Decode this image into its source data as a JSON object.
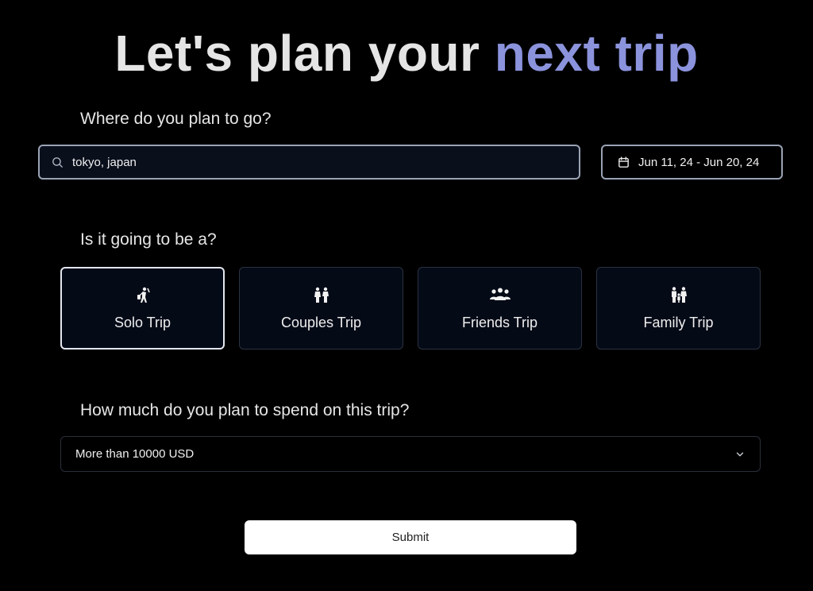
{
  "header": {
    "title_main": "Let's plan your",
    "title_accent": "next trip"
  },
  "colors": {
    "background": "#000000",
    "accent": "#8b93dd",
    "card_background": "#050a17"
  },
  "destination": {
    "question": "Where do you plan to go?",
    "value": "tokyo, japan",
    "icon": "search-icon"
  },
  "dates": {
    "label": "Jun 11, 24 - Jun 20, 24",
    "icon": "calendar-icon"
  },
  "trip_type": {
    "question": "Is it going to be a?",
    "options": [
      {
        "label": "Solo Trip",
        "icon": "solo-traveler-icon",
        "selected": true
      },
      {
        "label": "Couples Trip",
        "icon": "couple-icon",
        "selected": false
      },
      {
        "label": "Friends Trip",
        "icon": "group-icon",
        "selected": false
      },
      {
        "label": "Family Trip",
        "icon": "family-icon",
        "selected": false
      }
    ]
  },
  "budget": {
    "question": "How much do you plan to spend on this trip?",
    "selected": "More than 10000 USD",
    "icon": "chevron-down-icon"
  },
  "actions": {
    "submit_label": "Submit"
  }
}
